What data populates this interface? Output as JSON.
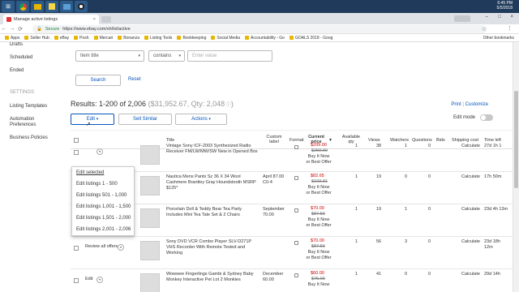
{
  "taskbar": {
    "clock_time": "6:45 PM",
    "clock_date": "5/5/2018",
    "icons": [
      "windows-icon",
      "chrome-icon",
      "folder-icon",
      "sticky-icon",
      "photos-icon",
      "obs-icon"
    ]
  },
  "browser": {
    "tab_title": "Manage active listings",
    "secure_label": "Secure",
    "url": "https://www.ebay.com/sh/lst/active"
  },
  "bookmarks": [
    "Apps",
    "Seller Hub",
    "eBay",
    "Posh",
    "Mercari",
    "Bonanza",
    "Listing Tools",
    "Bookkeeping",
    "Social Media",
    "Accountability - Go",
    "GOALS 2018 - Goog"
  ],
  "bookmarks_other": "Other bookmarks",
  "sidebar": {
    "items_top": [
      "Drafts",
      "Scheduled",
      "Ended"
    ],
    "settings_heading": "SETTINGS",
    "items_settings": [
      "Listing Templates",
      "Automation Preferences",
      "Business Policies"
    ]
  },
  "filter": {
    "field_value": "Item title",
    "operator_value": "contains",
    "value_placeholder": "Enter value",
    "search_label": "Search",
    "reset_label": "Reset"
  },
  "results": {
    "summary": "Results: 1-200 of 2,006",
    "totals": "($31,952.67, Qty: 2,048",
    "print": "Print",
    "separator": "|",
    "customize": "Customize",
    "edit_mode": "Edit mode"
  },
  "actions": {
    "edit": "Edit",
    "sell_similar": "Sell Similar",
    "actions": "Actions"
  },
  "dropdown": [
    "Edit selected",
    "Edit listings 1 - 500",
    "Edit listings 501 - 1,000",
    "Edit listings 1,001 - 1,500",
    "Edit listings 1,501 - 2,000",
    "Edit listings 2,001 - 2,006"
  ],
  "columns": {
    "title": "Title",
    "custom_label": "Custom label",
    "format": "Format",
    "current_price": "Current price",
    "available_qty": "Available qty",
    "views": "Views",
    "watchers": "Watchers",
    "questions": "Questions",
    "bids": "Bids",
    "shipping_cost": "Shipping cost",
    "time_left": "Time left"
  },
  "rows": [
    {
      "edit": "",
      "title": "Vintage Sony ICF-2003 Synthesized Radio Receiver FM/LW/MW/SW New in Opened Box",
      "custom": "",
      "price": "$209.00",
      "strike": "$259.00",
      "offer": "Buy It Now or Best Offer",
      "qty": "1",
      "views": "38",
      "watchers": "1",
      "questions": "0",
      "bids": "",
      "shipping": "Calculate",
      "time": "27d 1h 1"
    },
    {
      "edit": "",
      "title": "Nautica Mens Pants Sz 36 X 34 Wool Cashmere Brantley Gray Houndstooth MSRP $125*",
      "custom": "April 87.00 C0-4",
      "price": "$82.65",
      "strike": "$103.31",
      "offer": "Buy It Now or Best Offer",
      "qty": "1",
      "views": "19",
      "watchers": "0",
      "questions": "0",
      "bids": "",
      "shipping": "Calculate",
      "time": "17h 50m"
    },
    {
      "edit": "Edit",
      "title": "Porcelain Doll & Teddy Bear Tea Party Includes Mini Tea Tale Set & 2 Chairs",
      "custom": "September 70.00",
      "price": "$70.00",
      "strike": "$87.50",
      "offer": "Buy It Now or Best Offer",
      "qty": "1",
      "views": "19",
      "watchers": "1",
      "questions": "0",
      "bids": "",
      "shipping": "Calculate",
      "time": "23d 4h 13m"
    },
    {
      "edit": "Review all offers",
      "title": "Sony DVD VCR Combo Player SLV-D271P VHS Recorder With Remote Tested and Working",
      "custom": "",
      "price": "$70.00",
      "strike": "$87.50",
      "offer": "Buy It Now or Best Offer",
      "qty": "1",
      "views": "56",
      "watchers": "3",
      "questions": "0",
      "bids": "",
      "shipping": "Calculate",
      "time": "23d 18h 12m"
    },
    {
      "edit": "Edit",
      "title": "Wowwee Fingerlings Gambi & Sydney Baby Monkey Interactive Pet Lot 2 Monkies",
      "custom": "December 60.00",
      "price": "$60.00",
      "strike": "$75.00",
      "offer": "Buy It Now",
      "qty": "1",
      "views": "41",
      "watchers": "0",
      "questions": "0",
      "bids": "",
      "shipping": "Calculate",
      "time": "29d 14h"
    }
  ]
}
